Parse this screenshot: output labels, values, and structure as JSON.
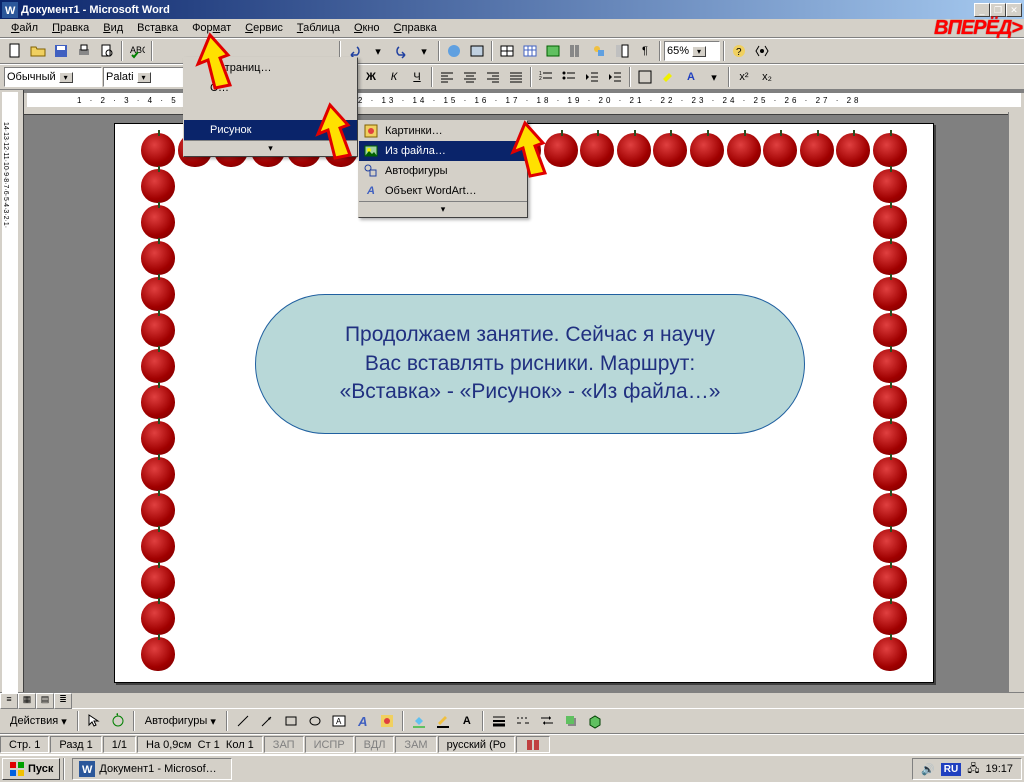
{
  "title": "Документ1 - Microsoft Word",
  "forward_label": "ВПЕРЁД>",
  "menu": {
    "file": "Файл",
    "edit": "Правка",
    "view": "Вид",
    "insert": "Вставка",
    "format": "Формат",
    "service": "Сервис",
    "table": "Таблица",
    "window": "Окно",
    "help": "Справка"
  },
  "insert_menu": {
    "page_numbers": "а страниц…",
    "picture": "Рисунок",
    "expand": "▾"
  },
  "picture_menu": {
    "clipart": "Картинки…",
    "from_file": "Из файла…",
    "autoshapes": "Автофигуры",
    "wordart": "Объект WordArt…",
    "expand": "▾"
  },
  "format_toolbar": {
    "style": "Обычный",
    "font": "Palati",
    "bold": "Ж",
    "italic": "К",
    "underline": "Ч",
    "super": "x²",
    "sub": "x₂"
  },
  "zoom": "65%",
  "ruler_text": "1 · 2 · 3 · 4 · 5 · 6 · 7 · 8 · 9 · 10 · 11 · 12 · 13 · 14 · 15 · 16 · 17 · 18 · 19 · 20 · 21 · 22 · 23 · 24 · 25 · 26 · 27 · 28",
  "vruler_text": "14·13·12·11·10·9·8·7·6·5·4·3·2·1·",
  "callout": {
    "line1": "Продолжаем занятие. Сейчас я научу",
    "line2": "Вас вставлять рисники. Маршрут:",
    "line3": "«Вставка» - «Рисунок» - «Из файла…»"
  },
  "drawbar": {
    "actions": "Действия",
    "autoshapes": "Автофигуры"
  },
  "status": {
    "page": "Стр. 1",
    "section": "Разд 1",
    "pages": "1/1",
    "at": "На 0,9см",
    "line": "Ст 1",
    "col": "Кол 1",
    "rec": "ЗАП",
    "trk": "ИСПР",
    "ext": "ВДЛ",
    "ovr": "ЗАМ",
    "lang": "русский (Ро"
  },
  "taskbar": {
    "start": "Пуск",
    "doc": "Документ1 - Microsof…",
    "lang_ind": "RU",
    "time": "19:17"
  }
}
